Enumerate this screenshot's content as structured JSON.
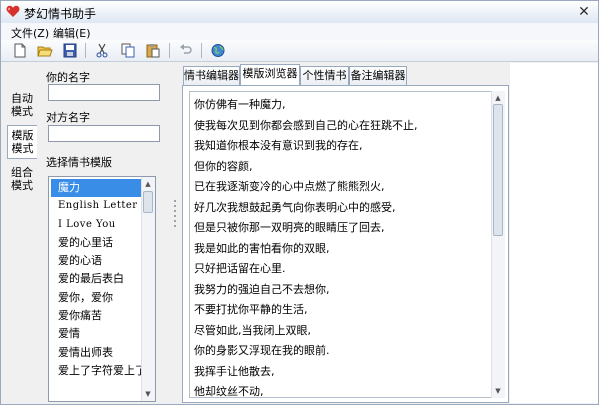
{
  "window": {
    "title": "梦幻情书助手",
    "accent": "#d6322b"
  },
  "menu": [
    {
      "label": "文件(Z)"
    },
    {
      "label": "编辑(E)"
    }
  ],
  "toolbar": {
    "icons": [
      "new-document-icon",
      "open-folder-icon",
      "save-icon",
      "cut-icon",
      "copy-icon",
      "paste-icon",
      "undo-icon",
      "browser-globe-icon"
    ]
  },
  "modes": [
    {
      "label": "自动模式"
    },
    {
      "label": "模版模式"
    },
    {
      "label": "组合模式"
    }
  ],
  "form": {
    "your_name_label": "你的名字",
    "your_name_value": "",
    "their_name_label": "对方名字",
    "their_name_value": "",
    "template_label": "选择情书模版"
  },
  "templates": {
    "selected": "魔力",
    "items": [
      "魔力",
      "English Letter",
      "I Love You",
      "爱的心里话",
      "爱的心语",
      "爱的最后表白",
      "爱你，爱你",
      "爱你痛苦",
      "爱情",
      "爱情出师表",
      "爱上了字符爱上了你"
    ]
  },
  "tabs": [
    {
      "label": "情书编辑器"
    },
    {
      "label": "模版浏览器"
    },
    {
      "label": "个性情书"
    },
    {
      "label": "备注编辑器"
    }
  ],
  "active_tab": "模版浏览器",
  "editor": {
    "lines": [
      "你仿佛有一种魔力,",
      "使我每次见到你都会感到自己的心在狂跳不止,",
      "我知道你根本没有意识到我的存在,",
      "但你的容颜,",
      "已在我逐渐变冷的心中点燃了熊熊烈火,",
      "好几次我想鼓起勇气向你表明心中的感受,",
      "但是只被你那一双明亮的眼睛压了回去,",
      "我是如此的害怕看你的双眼,",
      "只好把话留在心里.",
      "我努力的强迫自己不去想你,",
      "不要打扰你平静的生活,",
      "尽管如此,当我闭上双眼,",
      "你的身影又浮现在我的眼前.",
      "我挥手让他散去,",
      "他却纹丝不动,"
    ]
  }
}
